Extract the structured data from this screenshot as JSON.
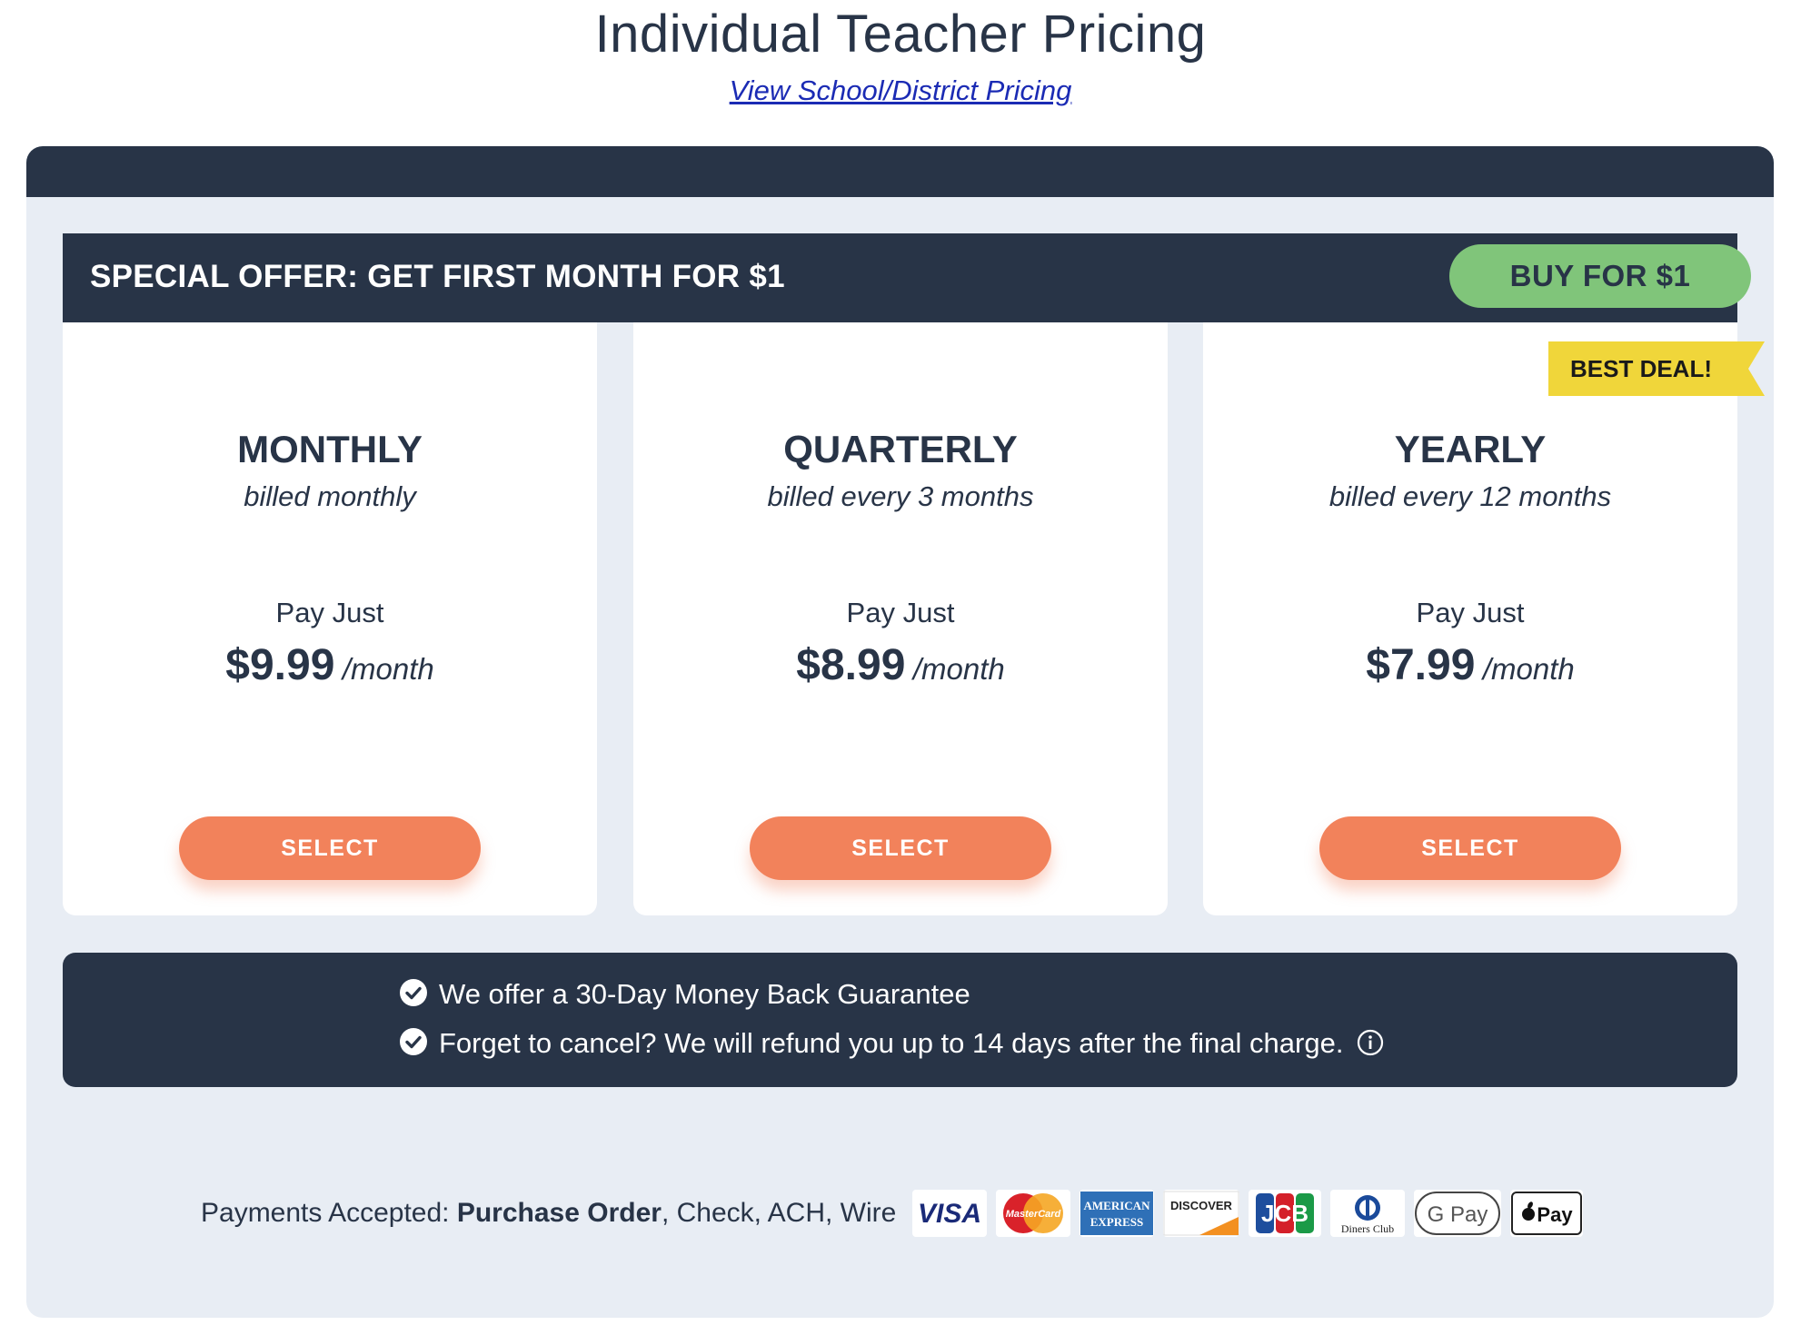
{
  "header": {
    "title": "Individual Teacher Pricing",
    "district_link": "View School/District Pricing"
  },
  "offer": {
    "text": "SPECIAL OFFER: GET FIRST MONTH FOR $1",
    "button_label": "BUY FOR $1"
  },
  "plans": [
    {
      "name": "MONTHLY",
      "billing": "billed monthly",
      "pay_label": "Pay Just",
      "price": "$9.99",
      "per": "/month",
      "button": "SELECT"
    },
    {
      "name": "QUARTERLY",
      "billing": "billed every 3 months",
      "pay_label": "Pay Just",
      "price": "$8.99",
      "per": "/month",
      "button": "SELECT"
    },
    {
      "name": "YEARLY",
      "billing": "billed every 12 months",
      "pay_label": "Pay Just",
      "price": "$7.99",
      "per": "/month",
      "button": "SELECT"
    }
  ],
  "best_deal": "BEST DEAL!",
  "guarantee": {
    "line1": "We offer a 30-Day Money Back Guarantee",
    "line2": "Forget to cancel? We will refund you up to 14 days after the final charge."
  },
  "payments": {
    "label": "Payments Accepted: ",
    "bold": "Purchase Order",
    "rest": ", Check, ACH, Wire",
    "logos": {
      "visa": "VISA",
      "mastercard": "MasterCard",
      "amex_top": "AMERICAN",
      "amex_bottom": "EXPRESS",
      "discover": "DISCOVER",
      "jcb": "JCB",
      "diners": "Diners Club",
      "gpay": "G Pay",
      "applepay": "Pay"
    }
  },
  "colors": {
    "navy": "#283447",
    "panel_bg": "#e8edf4",
    "green": "#80c57a",
    "orange": "#f2825b",
    "yellow": "#f0d63a",
    "link": "#1b2bb4"
  }
}
